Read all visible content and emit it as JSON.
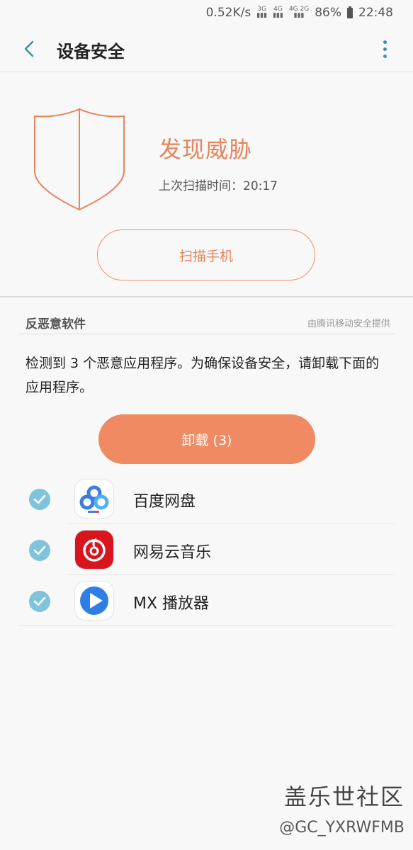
{
  "status_bar": {
    "speed": "0.52K/s",
    "net1": "3G",
    "net2": "4G",
    "net3": "4G 2G",
    "battery": "86%",
    "time": "22:48"
  },
  "header": {
    "title": "设备安全"
  },
  "summary": {
    "threat_title": "发现威胁",
    "last_scan": "上次扫描时间：20:17",
    "scan_button_label": "扫描手机"
  },
  "section": {
    "title": "反恶意软件",
    "provider": "由腾讯移动安全提供"
  },
  "message": "检测到 3 个恶意应用程序。为确保设备安全，请卸载下面的应用程序。",
  "uninstall_button_label": "卸载 (3)",
  "apps": [
    {
      "name": "百度网盘",
      "checked": true,
      "icon": "baidu-netdisk-icon"
    },
    {
      "name": "网易云音乐",
      "checked": true,
      "icon": "netease-music-icon"
    },
    {
      "name": "MX 播放器",
      "checked": true,
      "icon": "mx-player-icon"
    }
  ],
  "watermark": {
    "brand": "盖乐世社区",
    "user": "@GC_YXRWFMB"
  },
  "colors": {
    "accent_orange": "#f08a63",
    "shield_stroke": "#e7845b",
    "check_blue": "#7ec4dc",
    "header_blue": "#3a8fb0"
  }
}
